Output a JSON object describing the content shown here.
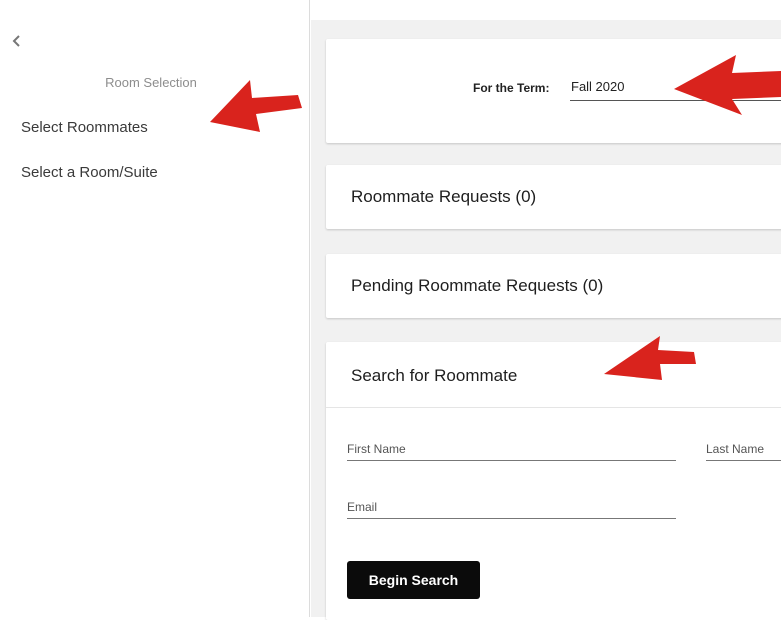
{
  "sidebar": {
    "heading": "Room Selection",
    "items": [
      {
        "label": "Select Roommates"
      },
      {
        "label": "Select a Room/Suite"
      }
    ]
  },
  "term": {
    "label": "For the Term:",
    "selected": "Fall 2020"
  },
  "sections": {
    "roommate_requests": "Roommate Requests (0)",
    "pending_requests": "Pending Roommate Requests (0)",
    "search": "Search for Roommate"
  },
  "search_form": {
    "first_name_placeholder": "First Name",
    "last_name_placeholder": "Last Name",
    "email_placeholder": "Email",
    "submit_label": "Begin Search"
  },
  "colors": {
    "annotation_arrow": "#d9231d",
    "button_bg": "#0b0b0b"
  }
}
